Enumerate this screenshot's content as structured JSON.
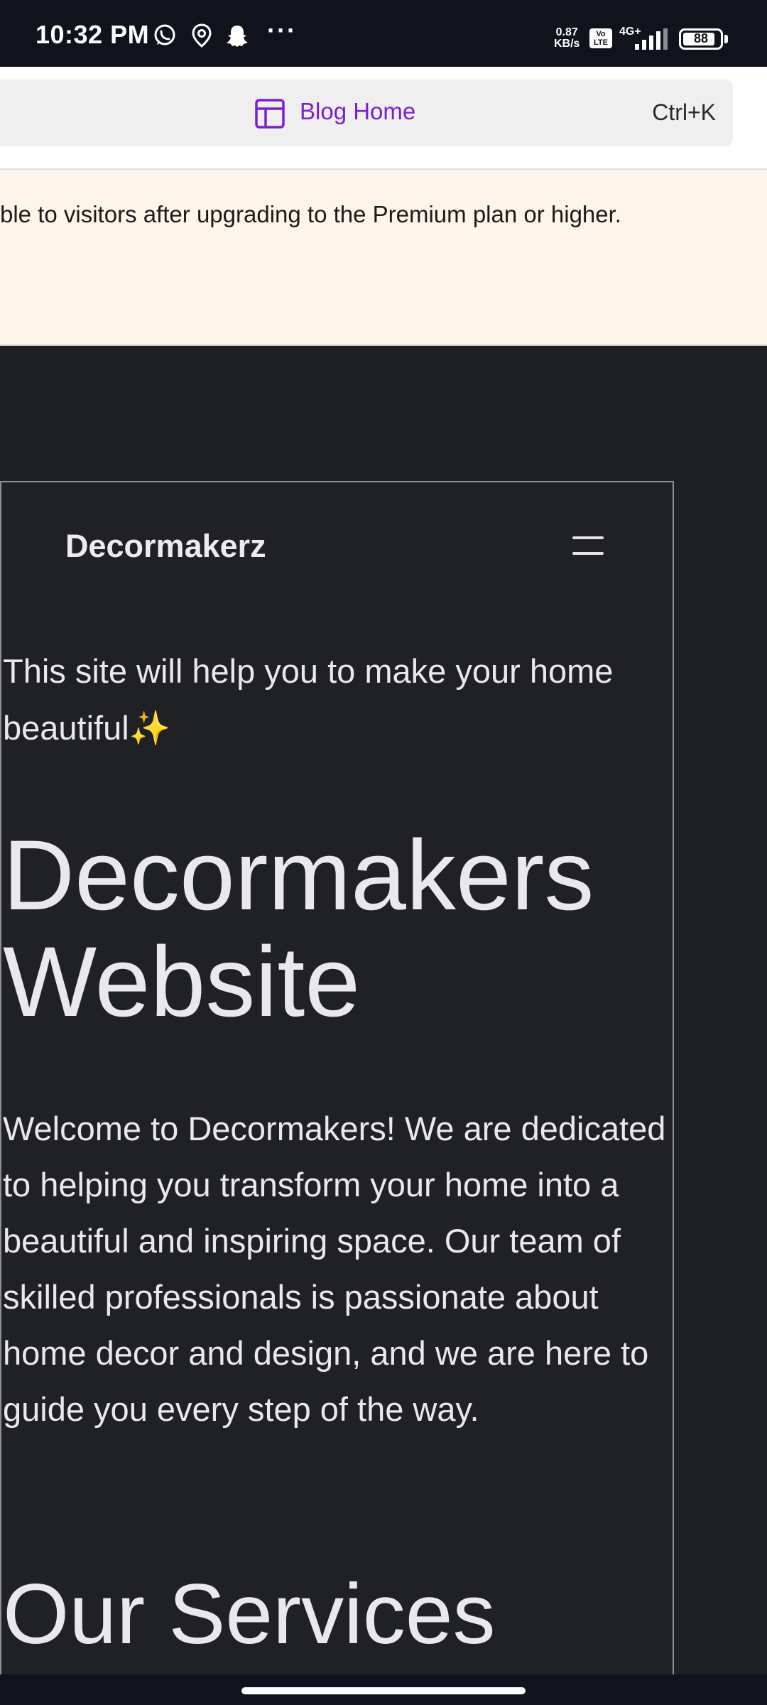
{
  "status_bar": {
    "time": "10:32 PM",
    "icons": [
      "whatsapp-icon",
      "location-icon",
      "snapchat-icon"
    ],
    "more": "···",
    "net_speed": "0.87",
    "net_speed_unit": "KB/s",
    "volte": "Vo LTE",
    "network": "4G+",
    "battery": "88",
    "battery_level": 0.88
  },
  "command_bar": {
    "icon": "layout-icon",
    "label": "Blog Home",
    "shortcut": "Ctrl+K"
  },
  "notice": {
    "text": "ble to visitors after upgrading to the Premium plan or higher."
  },
  "site": {
    "brand": "Decormakerz",
    "menu_icon": "hamburger-menu-icon",
    "tagline": "This site will help you to make your home beautiful✨",
    "hero_title": "Decormakers Website",
    "intro": "Welcome to Decormakers! We are dedicated to helping you transform your home into a beautiful and inspiring space. Our team of skilled professionals is passionate about home decor and design, and we are here to guide you every step of the way.",
    "services_title": "Our Services"
  },
  "colors": {
    "status_bg": "#10131c",
    "accent": "#7c1fd1",
    "notice_bg": "#fdf4ea",
    "site_bg": "#202125",
    "site_text": "#e8e8ee"
  }
}
